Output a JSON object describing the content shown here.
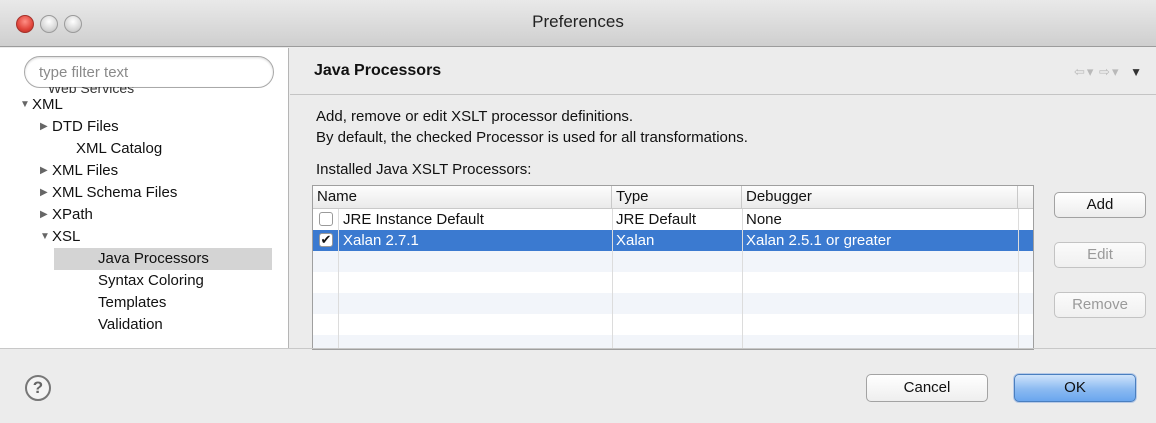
{
  "window": {
    "title": "Preferences"
  },
  "sidebar": {
    "filter_placeholder": "type filter text",
    "cutoff_item": "Web Services",
    "items": [
      {
        "label": "XML",
        "arrow": "▼"
      },
      {
        "label": "DTD Files",
        "arrow": "▶"
      },
      {
        "label": "XML Catalog",
        "arrow": ""
      },
      {
        "label": "XML Files",
        "arrow": "▶"
      },
      {
        "label": "XML Schema Files",
        "arrow": "▶"
      },
      {
        "label": "XPath",
        "arrow": "▶"
      },
      {
        "label": "XSL",
        "arrow": "▼"
      },
      {
        "label": "Java Processors",
        "arrow": ""
      },
      {
        "label": "Syntax Coloring",
        "arrow": ""
      },
      {
        "label": "Templates",
        "arrow": ""
      },
      {
        "label": "Validation",
        "arrow": ""
      }
    ]
  },
  "page": {
    "title": "Java Processors",
    "desc_line1": "Add, remove or edit XSLT processor definitions.",
    "desc_line2": "By default, the checked Processor is used for all transformations.",
    "installed_label": "Installed Java XSLT Processors:",
    "nav": {
      "back_icon": "⇦",
      "forward_icon": "⇨",
      "dropdown_icon": "▾",
      "menu_icon": "▼"
    }
  },
  "table": {
    "headers": [
      "Name",
      "Type",
      "Debugger"
    ],
    "rows": [
      {
        "checked": false,
        "name": "JRE Instance Default",
        "type": "JRE Default",
        "debugger": "None",
        "check_glyph": ""
      },
      {
        "checked": true,
        "name": "Xalan 2.7.1",
        "type": "Xalan",
        "debugger": "Xalan 2.5.1 or greater",
        "check_glyph": "✔"
      }
    ]
  },
  "side_buttons": {
    "add": "Add",
    "edit": "Edit",
    "remove": "Remove"
  },
  "footer": {
    "help_icon": "?",
    "cancel": "Cancel",
    "ok": "OK"
  },
  "colors": {
    "selection": "#3b7ad0",
    "default_button": "#8bbaf1"
  }
}
